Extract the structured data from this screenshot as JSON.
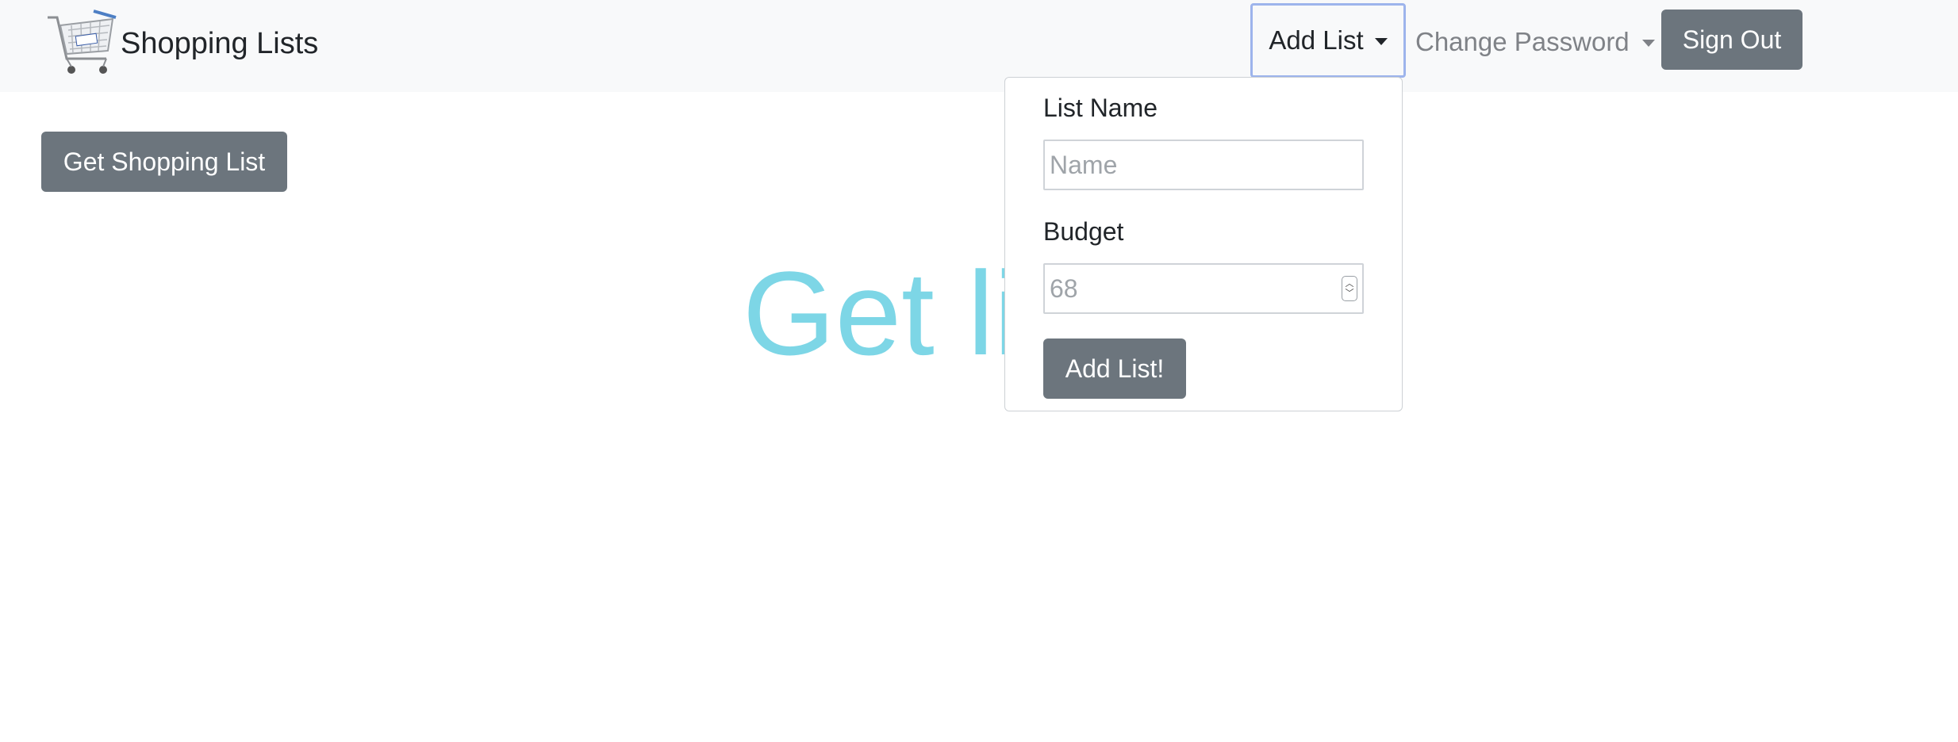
{
  "navbar": {
    "brand_title": "Shopping Lists",
    "add_list_label": "Add List",
    "change_password_label": "Change Password",
    "sign_out_label": "Sign Out"
  },
  "main": {
    "get_list_button": "Get Shopping List",
    "hero_text": "Get li"
  },
  "add_list_form": {
    "list_name_label": "List Name",
    "list_name_placeholder": "Name",
    "list_name_value": "",
    "budget_label": "Budget",
    "budget_placeholder": "68",
    "budget_value": "",
    "submit_label": "Add List!"
  },
  "colors": {
    "button_gray": "#6c757d",
    "navbar_bg": "#f8f9fa",
    "hero_text": "#7dd6e6",
    "focus_outline": "#9db4ec"
  },
  "icons": {
    "brand": "shopping-cart-icon",
    "dropdown": "caret-down-icon",
    "spinner": "number-spinner-icon"
  }
}
